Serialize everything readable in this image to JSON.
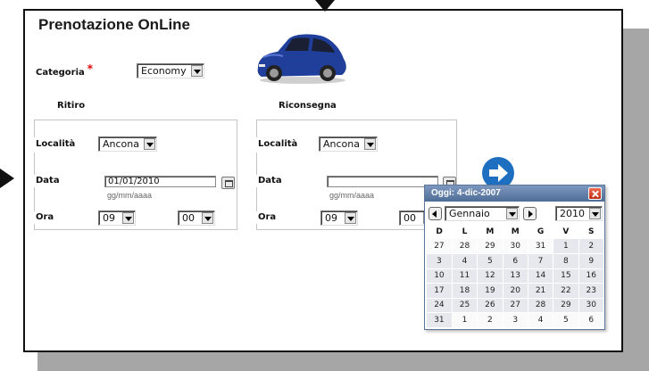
{
  "title": "Prenotazione OnLine",
  "categoria": {
    "label": "Categoria",
    "required_mark": "*",
    "value": "Economy"
  },
  "ritiro": {
    "heading": "Ritiro",
    "localita_label": "Località",
    "localita_value": "Ancona",
    "data_label": "Data",
    "data_value": "01/01/2010",
    "data_hint": "gg/mm/aaaa",
    "ora_label": "Ora",
    "hour_value": "09",
    "minute_value": "00"
  },
  "riconsegna": {
    "heading": "Riconsegna",
    "localita_label": "Località",
    "localita_value": "Ancona",
    "data_label": "Data",
    "data_value": "",
    "data_hint": "gg/mm/aaaa",
    "ora_label": "Ora",
    "hour_value": "09",
    "minute_value": "00"
  },
  "icons": {
    "car": "car-image",
    "go": "arrow-right-circle-icon",
    "calendar": "calendar-icon",
    "close": "close-icon"
  },
  "colors": {
    "accent_blue": "#1e6fc0",
    "car_blue": "#1f3f9a",
    "header_blue": "#5b7aa5",
    "close_red": "#d8432a",
    "required": "#e00000"
  },
  "calendar": {
    "today_label": "Oggi: 4-dic-2007",
    "month_value": "Gennaio",
    "year_value": "2010",
    "weekday_headers": [
      "D",
      "L",
      "M",
      "M",
      "G",
      "V",
      "S"
    ],
    "weeks": [
      [
        {
          "d": "27",
          "m": "prev"
        },
        {
          "d": "28",
          "m": "prev"
        },
        {
          "d": "29",
          "m": "prev"
        },
        {
          "d": "30",
          "m": "prev"
        },
        {
          "d": "31",
          "m": "prev"
        },
        {
          "d": "1",
          "m": "cur"
        },
        {
          "d": "2",
          "m": "cur"
        }
      ],
      [
        {
          "d": "3",
          "m": "cur"
        },
        {
          "d": "4",
          "m": "cur"
        },
        {
          "d": "5",
          "m": "cur"
        },
        {
          "d": "6",
          "m": "cur"
        },
        {
          "d": "7",
          "m": "cur"
        },
        {
          "d": "8",
          "m": "cur"
        },
        {
          "d": "9",
          "m": "cur"
        }
      ],
      [
        {
          "d": "10",
          "m": "cur"
        },
        {
          "d": "11",
          "m": "cur"
        },
        {
          "d": "12",
          "m": "cur"
        },
        {
          "d": "13",
          "m": "cur"
        },
        {
          "d": "14",
          "m": "cur"
        },
        {
          "d": "15",
          "m": "cur"
        },
        {
          "d": "16",
          "m": "cur"
        }
      ],
      [
        {
          "d": "17",
          "m": "cur"
        },
        {
          "d": "18",
          "m": "cur"
        },
        {
          "d": "19",
          "m": "cur"
        },
        {
          "d": "20",
          "m": "cur"
        },
        {
          "d": "21",
          "m": "cur"
        },
        {
          "d": "22",
          "m": "cur"
        },
        {
          "d": "23",
          "m": "cur"
        }
      ],
      [
        {
          "d": "24",
          "m": "cur"
        },
        {
          "d": "25",
          "m": "cur"
        },
        {
          "d": "26",
          "m": "cur"
        },
        {
          "d": "27",
          "m": "cur"
        },
        {
          "d": "28",
          "m": "cur"
        },
        {
          "d": "29",
          "m": "cur"
        },
        {
          "d": "30",
          "m": "cur"
        }
      ],
      [
        {
          "d": "31",
          "m": "cur"
        },
        {
          "d": "1",
          "m": "next"
        },
        {
          "d": "2",
          "m": "next"
        },
        {
          "d": "3",
          "m": "next"
        },
        {
          "d": "4",
          "m": "next"
        },
        {
          "d": "5",
          "m": "next"
        },
        {
          "d": "6",
          "m": "next"
        }
      ]
    ]
  }
}
